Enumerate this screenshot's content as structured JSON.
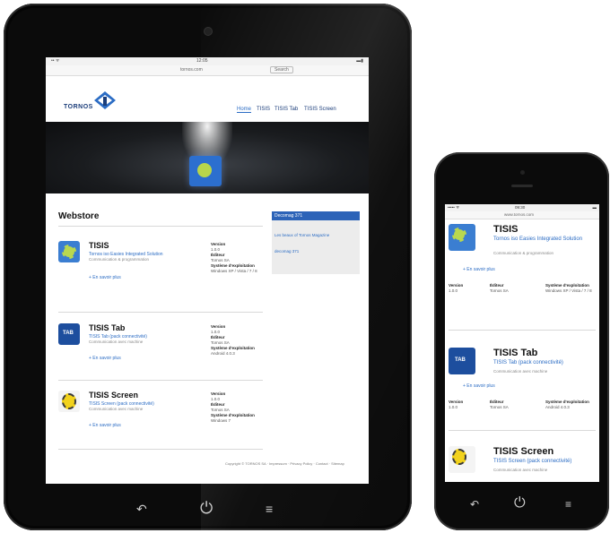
{
  "tablet": {
    "status_left": "•• ᯤ",
    "status_time": "12:05",
    "status_right": "▬▮",
    "url_text": "tornos.com",
    "url_search": "Search",
    "logo_text": "TORNOS",
    "nav": [
      "Home",
      "TISIS",
      "TISIS Tab",
      "TISIS Screen"
    ],
    "page_title": "Webstore",
    "apps": [
      {
        "name": "TISIS",
        "link": "Tornos iso Easies Integrated Solution",
        "desc": "Communication & programmation",
        "more": "+ En savoir plus",
        "meta": [
          {
            "k": "Version",
            "v": "1.0.0"
          },
          {
            "k": "Éditeur",
            "v": "Tornos SA"
          },
          {
            "k": "Système d'exploitation",
            "v": "Windows XP / Vista / 7 / 8"
          }
        ]
      },
      {
        "name": "TISIS Tab",
        "link": "TISIS Tab (pack connectivité)",
        "desc": "Communication avec machine",
        "more": "+ En savoir plus",
        "meta": [
          {
            "k": "Version",
            "v": "1.0.0"
          },
          {
            "k": "Éditeur",
            "v": "Tornos SA"
          },
          {
            "k": "Système d'exploitation",
            "v": "Android 4.0.3"
          }
        ]
      },
      {
        "name": "TISIS Screen",
        "link": "TISIS Screen (pack connectivité)",
        "desc": "Communication avec machine",
        "more": "+ En savoir plus",
        "meta": [
          {
            "k": "Version",
            "v": "1.0.0"
          },
          {
            "k": "Éditeur",
            "v": "Tornos SA"
          },
          {
            "k": "Système d'exploitation",
            "v": "Windows 7"
          }
        ]
      }
    ],
    "sidebar_head": "Decomag 371",
    "sidebar_items": [
      "Les beaux of Tornos Magazine",
      "decomag 371"
    ],
    "footer": "Copyright © TORNOS SA · Impressum · Privacy Policy · Contact · Sitemap",
    "buttons": {
      "back": "↶",
      "power": "⏻",
      "menu": "≡"
    }
  },
  "phone": {
    "status_left": "••••• ᯤ",
    "status_time": "09:30",
    "status_right": "▬",
    "url_text": "www.tornos.com",
    "apps": [
      {
        "name": "TISIS",
        "link": "Tornos iso Easies Integrated Solution",
        "desc": "Communication & programmation",
        "more": "+ En savoir plus",
        "meta": [
          {
            "k": "Version",
            "v": "1.0.0"
          },
          {
            "k": "Éditeur",
            "v": "Tornos SA"
          },
          {
            "k": "Système d'exploitation",
            "v": "Windows XP / Vista / 7 / 8"
          }
        ]
      },
      {
        "name": "TISIS Tab",
        "link": "TISIS Tab (pack connectivité)",
        "desc": "Communication avec machine",
        "more": "+ En savoir plus",
        "meta": [
          {
            "k": "Version",
            "v": "1.0.0"
          },
          {
            "k": "Éditeur",
            "v": "Tornos SA"
          },
          {
            "k": "Système d'exploitation",
            "v": "Android 4.0.3"
          }
        ]
      },
      {
        "name": "TISIS Screen",
        "link": "TISIS Screen (pack connectivité)",
        "desc": "Communication avec machine",
        "more": "",
        "meta": []
      }
    ],
    "buttons": {
      "back": "↶",
      "power": "⏻",
      "menu": "≡"
    }
  },
  "colors": {
    "brand_blue": "#1b3d7a",
    "link_blue": "#2b6cc4",
    "accent_green": "#b9d84f",
    "accent_yellow": "#f2d21c"
  }
}
